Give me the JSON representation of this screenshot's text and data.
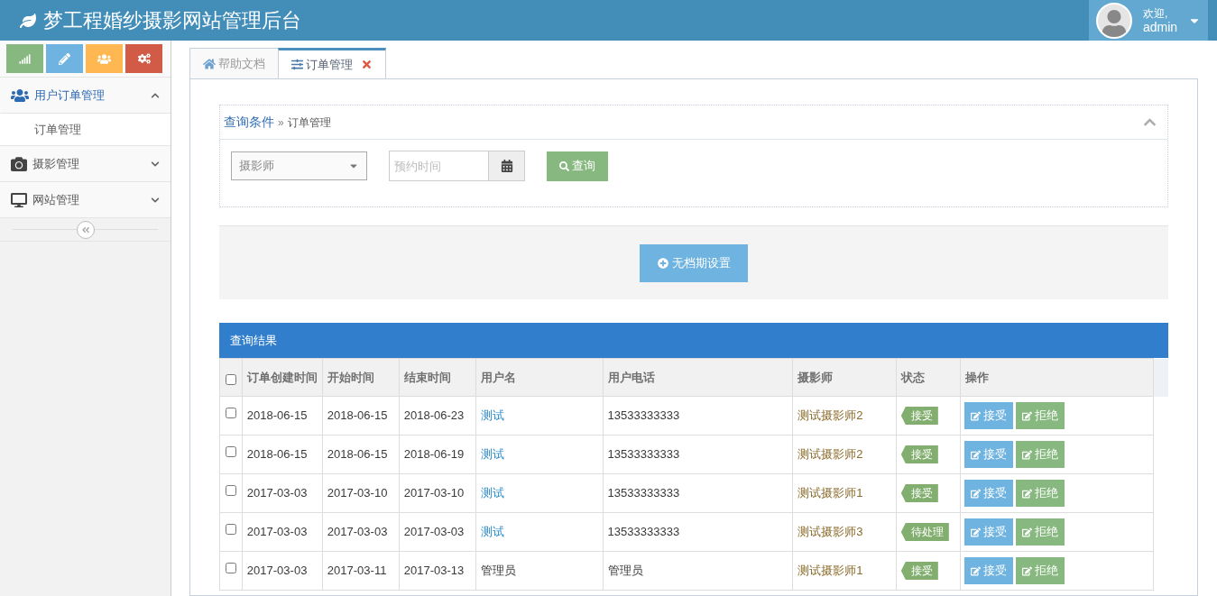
{
  "header": {
    "title": "梦工程婚纱摄影网站管理后台",
    "user": {
      "greeting": "欢迎,",
      "name": "admin"
    }
  },
  "sidebar": {
    "shortcuts": [
      {
        "kind": "chart",
        "color": "#87b87f"
      },
      {
        "kind": "pencil",
        "color": "#6fb3e0"
      },
      {
        "kind": "users",
        "color": "#ffb752"
      },
      {
        "kind": "cogs",
        "color": "#d15b47"
      }
    ],
    "items": [
      {
        "label": "用户订单管理",
        "expanded": true,
        "children": [
          {
            "label": "订单管理"
          }
        ]
      },
      {
        "label": "摄影管理",
        "expanded": false
      },
      {
        "label": "网站管理",
        "expanded": false
      }
    ]
  },
  "tabs": [
    {
      "label": "帮助文档",
      "selected": false,
      "closable": false
    },
    {
      "label": "订单管理",
      "selected": true,
      "closable": true
    }
  ],
  "query": {
    "breadcrumb": "查询条件",
    "separator": "»",
    "current": "订单管理",
    "photographer_select": "摄影师",
    "date_placeholder": "预约时间",
    "search_button": "查询"
  },
  "schedule_button": "无档期设置",
  "results": {
    "title": "查询结果",
    "all_checked": false,
    "columns": [
      "订单创建时间",
      "开始时间",
      "结束时间",
      "用户名",
      "用户电话",
      "摄影师",
      "状态",
      "操作"
    ],
    "rows": [
      {
        "checked": false,
        "created": "2018-06-15",
        "start": "2018-06-15",
        "end": "2018-06-23",
        "user": "测试",
        "user_link": true,
        "phone": "13533333333",
        "photographer": "测试摄影师2",
        "status": "接受",
        "actions": [
          "接受",
          "拒绝"
        ]
      },
      {
        "checked": false,
        "created": "2018-06-15",
        "start": "2018-06-15",
        "end": "2018-06-19",
        "user": "测试",
        "user_link": true,
        "phone": "13533333333",
        "photographer": "测试摄影师2",
        "status": "接受",
        "actions": [
          "接受",
          "拒绝"
        ]
      },
      {
        "checked": false,
        "created": "2017-03-03",
        "start": "2017-03-10",
        "end": "2017-03-10",
        "user": "测试",
        "user_link": true,
        "phone": "13533333333",
        "photographer": "测试摄影师1",
        "status": "接受",
        "actions": [
          "接受",
          "拒绝"
        ]
      },
      {
        "checked": false,
        "created": "2017-03-03",
        "start": "2017-03-03",
        "end": "2017-03-03",
        "user": "测试",
        "user_link": true,
        "phone": "13533333333",
        "photographer": "测试摄影师3",
        "status": "待处理",
        "actions": [
          "接受",
          "拒绝"
        ]
      },
      {
        "checked": false,
        "created": "2017-03-03",
        "start": "2017-03-11",
        "end": "2017-03-13",
        "user": "管理员",
        "user_link": false,
        "phone": "管理员",
        "photographer": "测试摄影师1",
        "status": "接受",
        "actions": [
          "接受",
          "拒绝"
        ]
      }
    ]
  }
}
